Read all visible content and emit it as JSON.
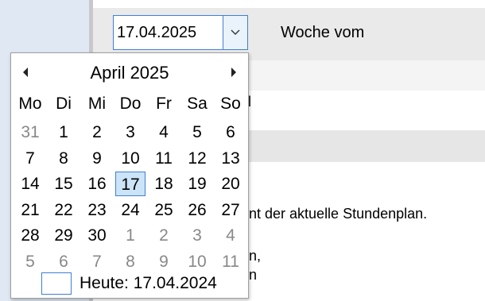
{
  "toolbar": {
    "date_value": "17.04.2025",
    "week_label": "Woche vom"
  },
  "background_text": {
    "line1": "l",
    "line2": "nt der aktuelle Stundenplan.",
    "line3": "n,",
    "line4": "n"
  },
  "calendar": {
    "month_title": "April 2025",
    "weekdays": [
      "Mo",
      "Di",
      "Mi",
      "Do",
      "Fr",
      "Sa",
      "So"
    ],
    "weeks": [
      [
        "31",
        "1",
        "2",
        "3",
        "4",
        "5",
        "6"
      ],
      [
        "7",
        "8",
        "9",
        "10",
        "11",
        "12",
        "13"
      ],
      [
        "14",
        "15",
        "16",
        "17",
        "18",
        "19",
        "20"
      ],
      [
        "21",
        "22",
        "23",
        "24",
        "25",
        "26",
        "27"
      ],
      [
        "28",
        "29",
        "30",
        "1",
        "2",
        "3",
        "4"
      ],
      [
        "5",
        "6",
        "7",
        "8",
        "9",
        "10",
        "11"
      ]
    ],
    "other_month": [
      [
        true,
        false,
        false,
        false,
        false,
        false,
        false
      ],
      [
        false,
        false,
        false,
        false,
        false,
        false,
        false
      ],
      [
        false,
        false,
        false,
        false,
        false,
        false,
        false
      ],
      [
        false,
        false,
        false,
        false,
        false,
        false,
        false
      ],
      [
        false,
        false,
        false,
        true,
        true,
        true,
        true
      ],
      [
        true,
        true,
        true,
        true,
        true,
        true,
        true
      ]
    ],
    "selected": "17",
    "today_label": "Heute: 17.04.2024"
  },
  "colors": {
    "accent": "#3f7fd4",
    "selected_bg": "#cce4f7",
    "other_month_text": "#888888"
  },
  "icons": {
    "dropdown": "chevron-down-icon",
    "prev": "triangle-left-icon",
    "next": "triangle-right-icon"
  }
}
